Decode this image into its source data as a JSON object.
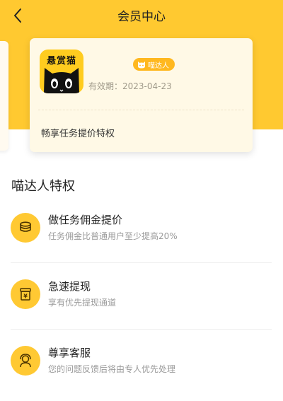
{
  "nav": {
    "title": "会员中心",
    "back_icon": "chevron-left-icon"
  },
  "card": {
    "logo_text": "悬赏猫",
    "badge_label": "喵达人",
    "validity": "有效期：2023-04-23",
    "description": "畅享任务提价特权"
  },
  "section": {
    "title": "喵达人特权"
  },
  "privileges": [
    {
      "title": "做任务佣金提价",
      "desc": "任务佣金比普通用户至少提高20%",
      "icon": "coins-icon"
    },
    {
      "title": "急速提现",
      "desc": "享有优先提现通道",
      "icon": "cash-box-icon"
    },
    {
      "title": "尊享客服",
      "desc": "您的问题反馈后将由专人优先处理",
      "icon": "customer-service-icon"
    }
  ],
  "colors": {
    "brand_yellow": "#FFC930",
    "card_bg": "#FFF9E6",
    "badge": "#FFB81F"
  }
}
